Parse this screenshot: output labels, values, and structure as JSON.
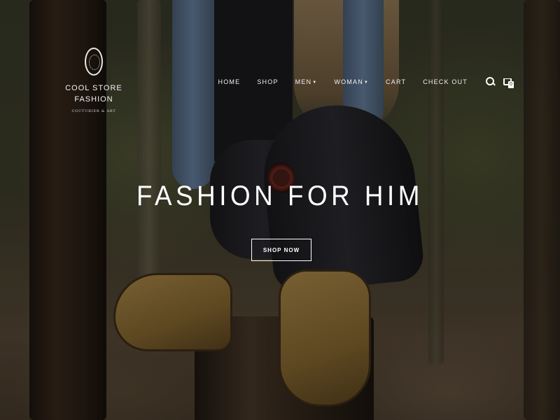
{
  "brand": {
    "name": "COOL STORE FASHION",
    "name_line1": "COOL STORE",
    "name_line2": "FASHION",
    "tagline": "COUTURIER & ART"
  },
  "nav": {
    "items": [
      {
        "label": "HOME"
      },
      {
        "label": "SHOP"
      },
      {
        "label": "MEN",
        "dropdown": true
      },
      {
        "label": "WOMAN",
        "dropdown": true
      },
      {
        "label": "CART"
      },
      {
        "label": "CHECK OUT"
      }
    ],
    "search_icon": "search-icon",
    "cart_icon": "cart-icon",
    "cart_count": "0"
  },
  "hero": {
    "title": "FASHION FOR HIM",
    "cta_label": "SHOP NOW"
  },
  "colors": {
    "text": "#ffffff",
    "overlay": "rgba(0,0,0,0.32)"
  }
}
